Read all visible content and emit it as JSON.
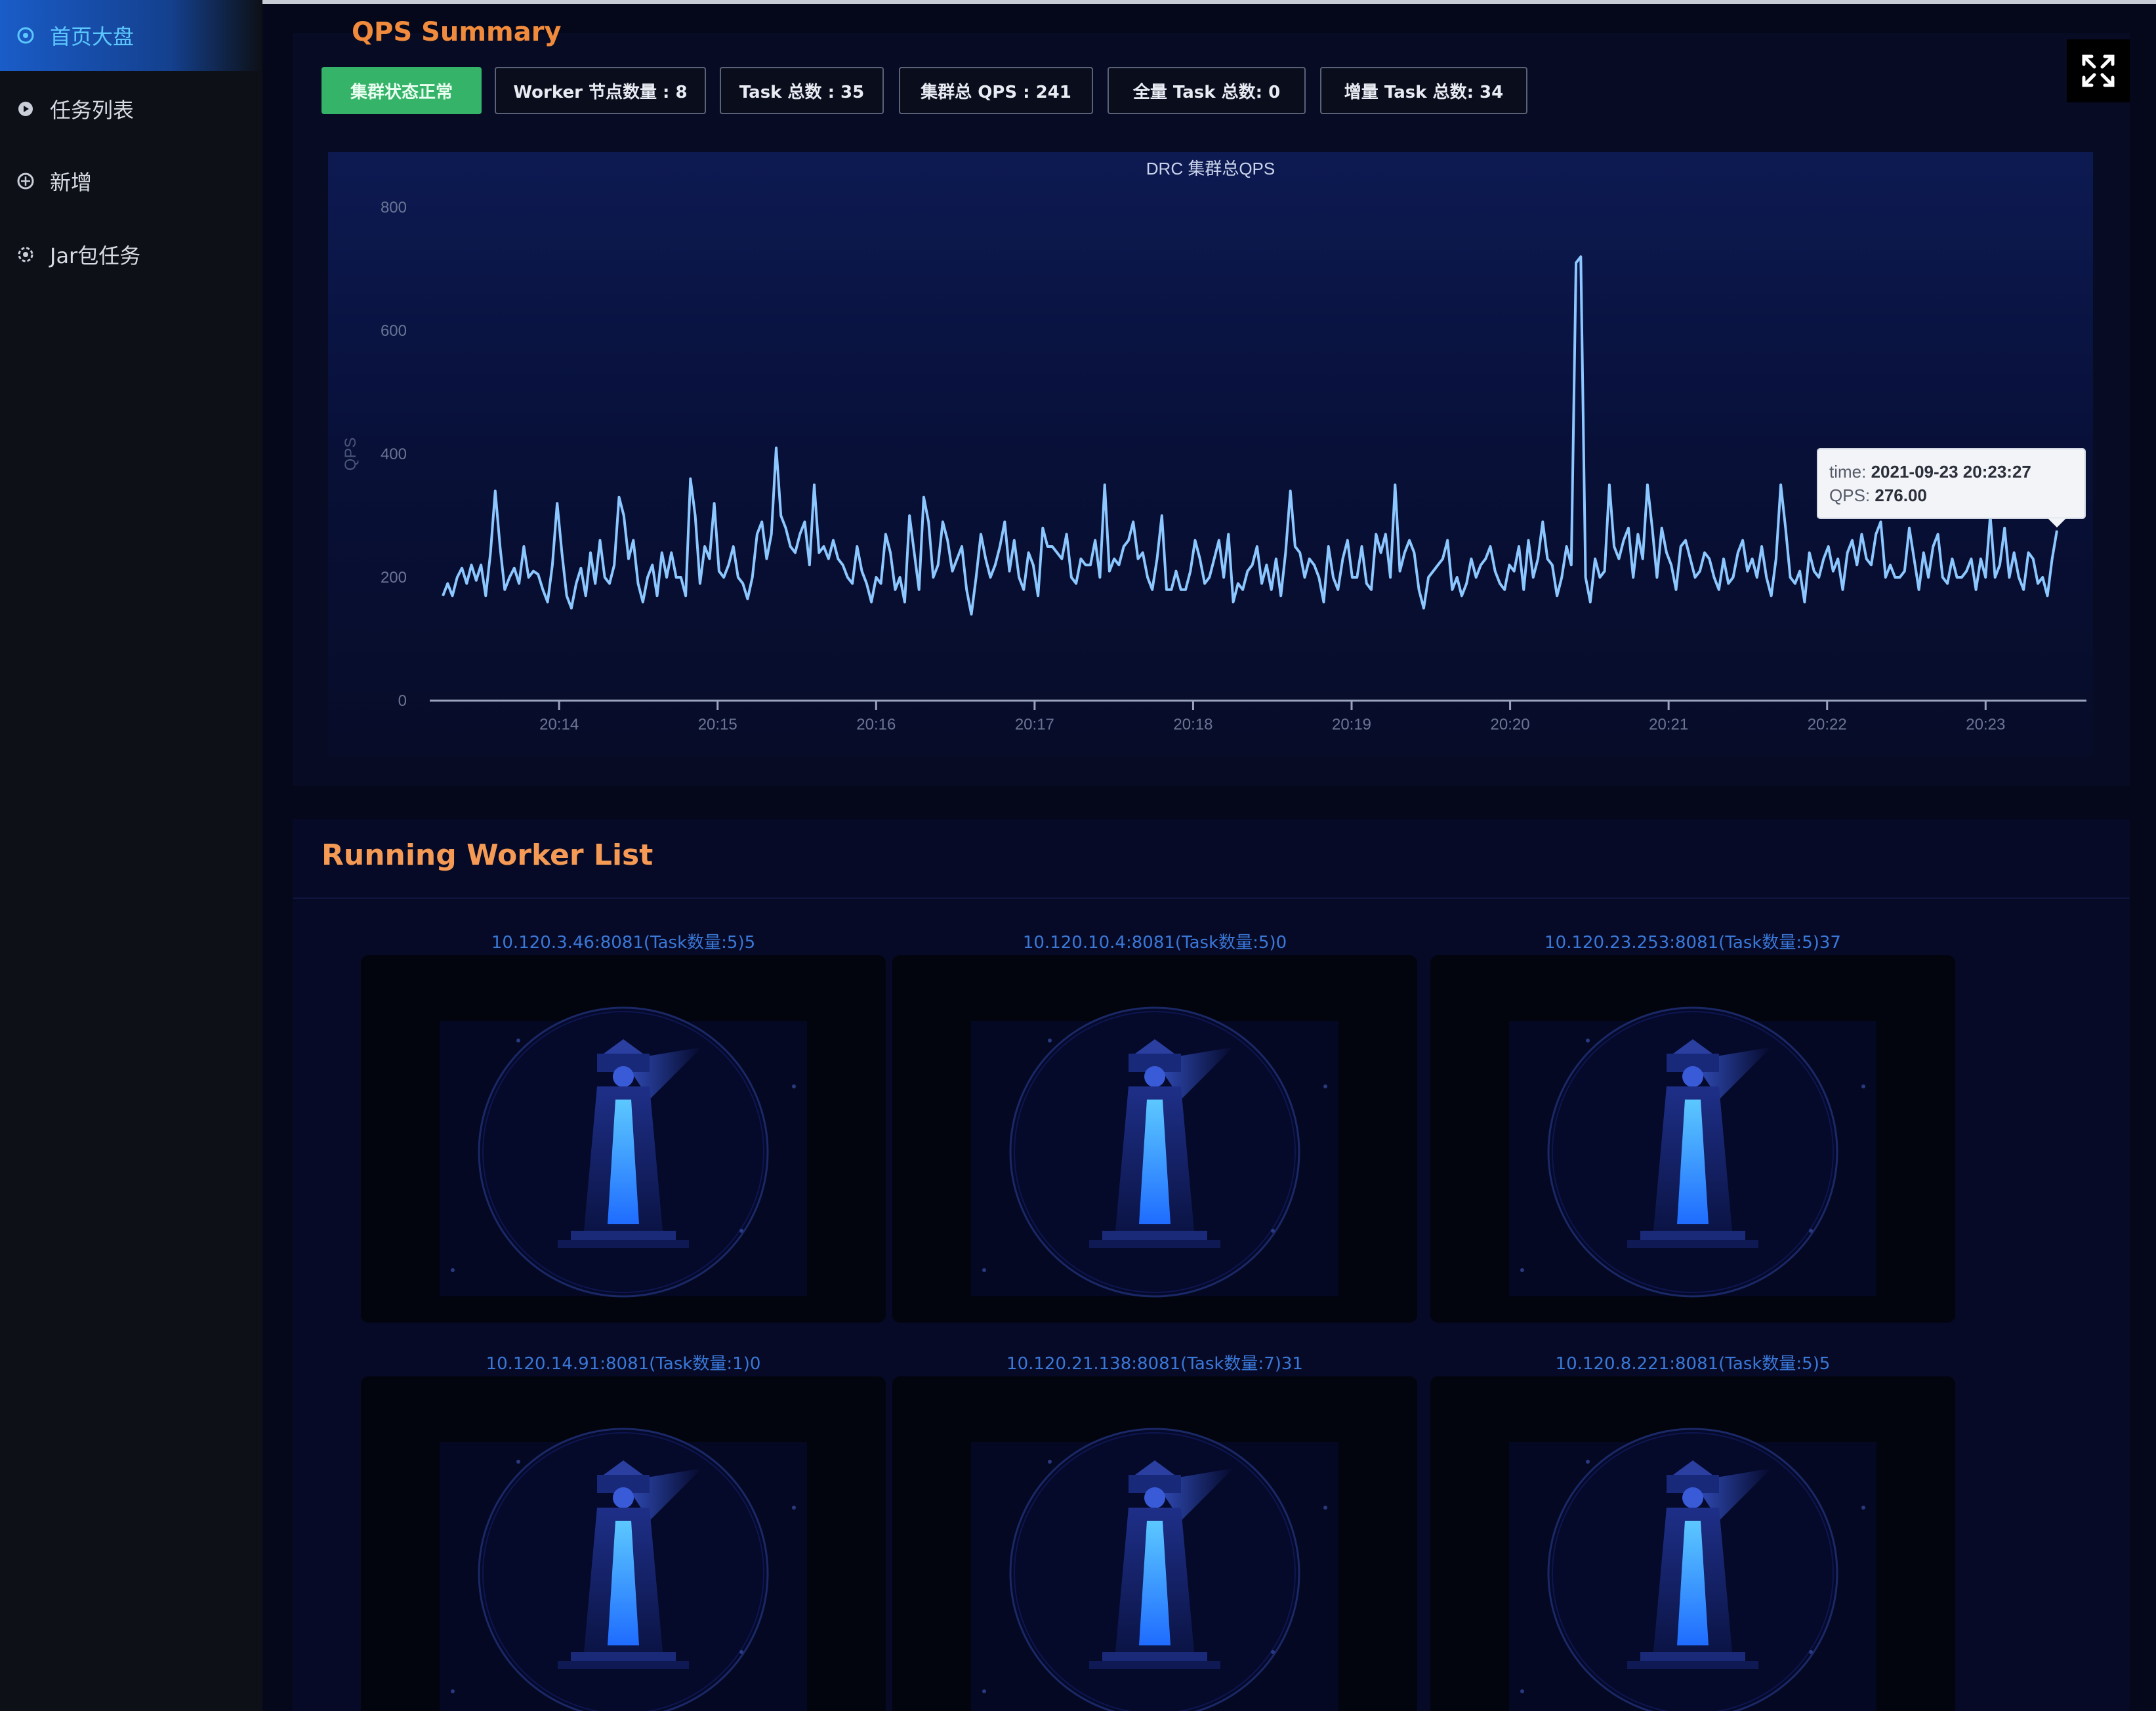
{
  "sidebar": {
    "items": [
      {
        "label": "首页大盘",
        "icon": "dashboard-icon",
        "active": true
      },
      {
        "label": "任务列表",
        "icon": "list-icon",
        "active": false
      },
      {
        "label": "新增",
        "icon": "add-icon",
        "active": false
      },
      {
        "label": "Jar包任务",
        "icon": "jar-icon",
        "active": false
      }
    ]
  },
  "summary": {
    "title": "QPS Summary",
    "stats": [
      {
        "label": "集群状态正常",
        "status": "ok"
      },
      {
        "label": "Worker 节点数量 : 8"
      },
      {
        "label": "Task 总数 : 35"
      },
      {
        "label": "集群总 QPS : 241"
      },
      {
        "label": "全量 Task 总数:  0"
      },
      {
        "label": "增量 Task 总数:  34"
      }
    ],
    "fullscreen_icon": "fullscreen-icon"
  },
  "chart_data": {
    "type": "line",
    "title": "DRC 集群总QPS",
    "ylabel": "QPS",
    "xlabel": "",
    "ylim": [
      0,
      800
    ],
    "yticks": [
      "0",
      "200",
      "400",
      "600",
      "800"
    ],
    "xticks": [
      "20:14",
      "20:15",
      "20:16",
      "20:17",
      "20:18",
      "20:19",
      "20:20",
      "20:21",
      "20:22",
      "20:23"
    ],
    "x_start": "20:13:16",
    "x_end": "20:23:27",
    "series": [
      {
        "color": "#8cc8ff",
        "values": [
          170,
          190,
          170,
          200,
          215,
          190,
          220,
          195,
          220,
          170,
          240,
          340,
          250,
          180,
          200,
          215,
          190,
          250,
          200,
          210,
          205,
          180,
          160,
          220,
          320,
          240,
          170,
          150,
          190,
          215,
          170,
          240,
          190,
          260,
          200,
          190,
          220,
          330,
          300,
          230,
          260,
          190,
          160,
          200,
          220,
          170,
          240,
          200,
          240,
          200,
          200,
          170,
          360,
          300,
          190,
          250,
          230,
          320,
          210,
          200,
          220,
          250,
          200,
          190,
          165,
          200,
          270,
          290,
          230,
          270,
          410,
          300,
          280,
          250,
          240,
          270,
          290,
          220,
          350,
          240,
          250,
          230,
          260,
          230,
          220,
          200,
          190,
          250,
          210,
          190,
          160,
          200,
          190,
          270,
          240,
          180,
          200,
          160,
          300,
          240,
          180,
          330,
          290,
          200,
          220,
          290,
          260,
          210,
          230,
          250,
          180,
          140,
          200,
          270,
          230,
          200,
          220,
          250,
          290,
          210,
          260,
          200,
          180,
          240,
          220,
          170,
          280,
          250,
          250,
          240,
          230,
          270,
          200,
          190,
          230,
          220,
          220,
          260,
          200,
          350,
          210,
          230,
          220,
          250,
          260,
          290,
          230,
          240,
          200,
          180,
          230,
          300,
          180,
          180,
          210,
          180,
          180,
          210,
          260,
          230,
          190,
          200,
          230,
          260,
          200,
          270,
          160,
          190,
          180,
          210,
          220,
          250,
          190,
          220,
          180,
          230,
          170,
          240,
          340,
          250,
          240,
          200,
          230,
          220,
          200,
          160,
          250,
          200,
          180,
          230,
          260,
          200,
          200,
          250,
          190,
          180,
          270,
          240,
          270,
          200,
          350,
          210,
          240,
          260,
          240,
          180,
          150,
          200,
          210,
          220,
          230,
          260,
          180,
          200,
          170,
          190,
          230,
          200,
          220,
          230,
          250,
          210,
          190,
          180,
          220,
          210,
          250,
          180,
          260,
          200,
          230,
          290,
          230,
          220,
          170,
          200,
          250,
          220,
          710,
          720,
          200,
          160,
          230,
          200,
          210,
          350,
          250,
          230,
          260,
          280,
          200,
          270,
          230,
          350,
          280,
          200,
          280,
          240,
          220,
          180,
          250,
          260,
          230,
          200,
          210,
          240,
          230,
          200,
          180,
          230,
          190,
          200,
          240,
          260,
          210,
          230,
          200,
          250,
          200,
          170,
          230,
          350,
          280,
          200,
          190,
          210,
          160,
          240,
          210,
          200,
          230,
          250,
          210,
          230,
          180,
          240,
          260,
          220,
          270,
          230,
          220,
          270,
          290,
          200,
          220,
          200,
          200,
          210,
          280,
          230,
          180,
          240,
          200,
          250,
          270,
          200,
          190,
          230,
          200,
          200,
          210,
          230,
          180,
          230,
          200,
          300,
          200,
          220,
          280,
          200,
          240,
          200,
          180,
          240,
          230,
          190,
          200,
          170,
          230,
          276
        ]
      }
    ],
    "tooltip": {
      "time": "2021-09-23 20:23:27",
      "qps": "276.00"
    }
  },
  "workers": {
    "title": "Running Worker List",
    "items": [
      {
        "label": "10.120.3.46:8081(Task数量:5)5"
      },
      {
        "label": "10.120.10.4:8081(Task数量:5)0"
      },
      {
        "label": "10.120.23.253:8081(Task数量:5)37"
      },
      {
        "label": "10.120.14.91:8081(Task数量:1)0"
      },
      {
        "label": "10.120.21.138:8081(Task数量:7)31"
      },
      {
        "label": "10.120.8.221:8081(Task数量:5)5"
      }
    ],
    "card_icon": "lighthouse-icon"
  },
  "colors": {
    "accent": "#1a5cc8",
    "status_ok": "#35b368",
    "title_orange": "#f59a55",
    "line": "#8cc8ff",
    "worker_label": "#3a78d8"
  }
}
